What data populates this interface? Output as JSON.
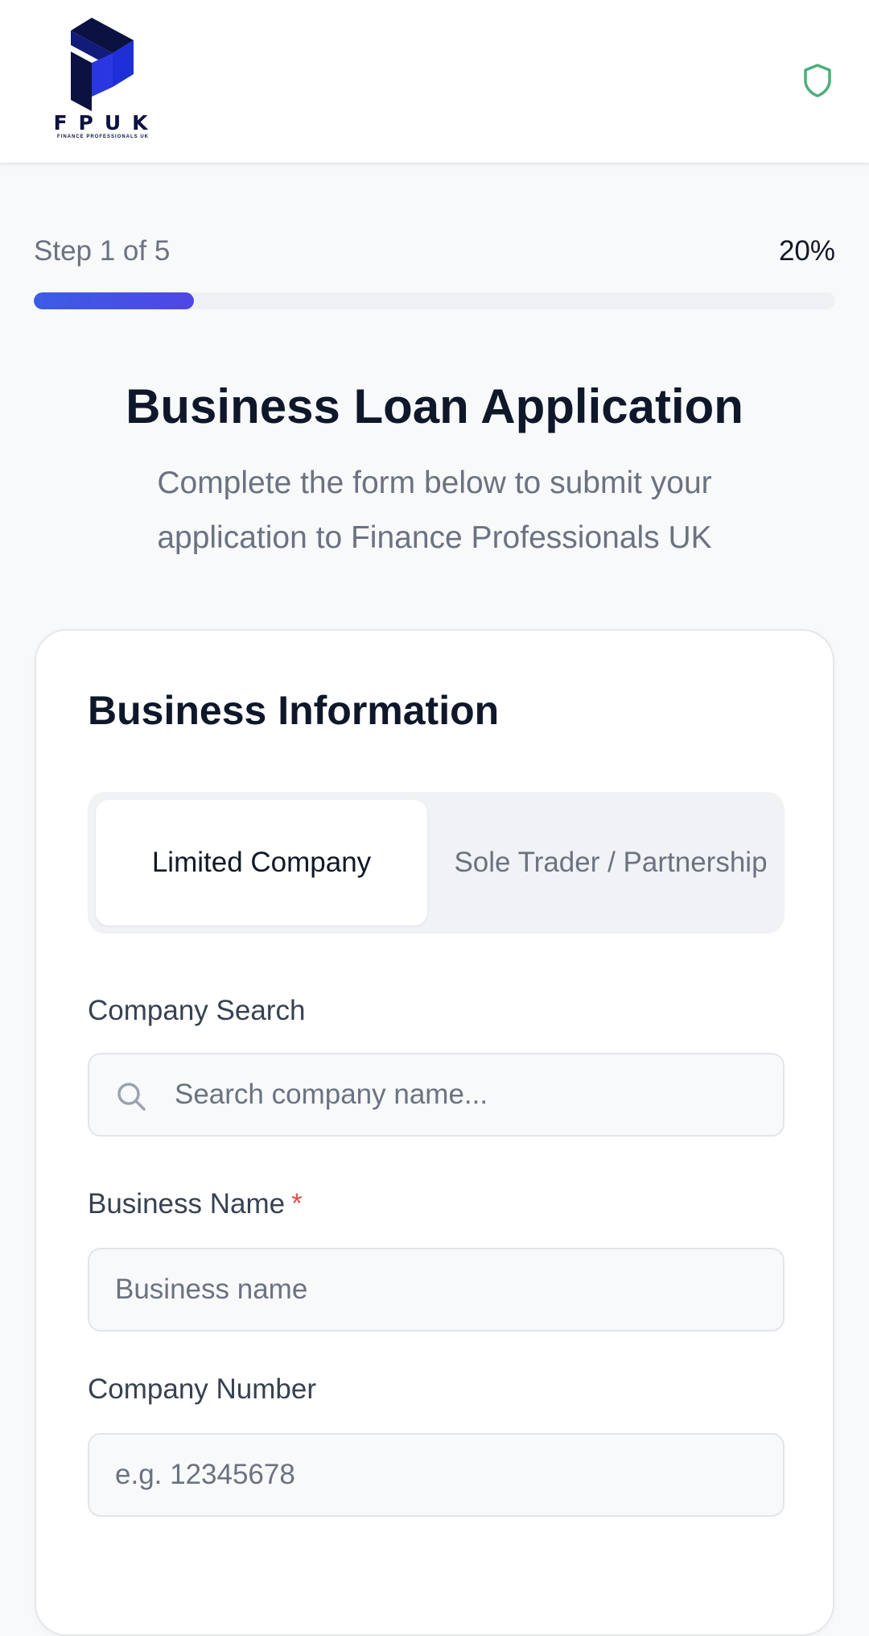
{
  "header": {
    "logo_text": "FPUK",
    "logo_subtext": "FINANCE PROFESSIONALS UK",
    "security_icon": "shield-icon",
    "shield_color": "#4caf7a"
  },
  "progress": {
    "step_label": "Step 1 of 5",
    "percent_label": "20%",
    "percent_value": 20,
    "bar_color": "#4353e6"
  },
  "page": {
    "title": "Business Loan Application",
    "subtitle": "Complete the form below to submit your application to Finance Professionals UK"
  },
  "card": {
    "title": "Business Information",
    "business_type": {
      "options": [
        "Limited Company",
        "Sole Trader / Partnership"
      ],
      "selected": "Limited Company"
    },
    "fields": {
      "company_search": {
        "label": "Company Search",
        "placeholder": "Search company name..."
      },
      "business_name": {
        "label": "Business Name",
        "required_mark": "*",
        "placeholder": "Business name"
      },
      "company_number": {
        "label": "Company Number",
        "placeholder": "e.g. 12345678"
      }
    }
  }
}
